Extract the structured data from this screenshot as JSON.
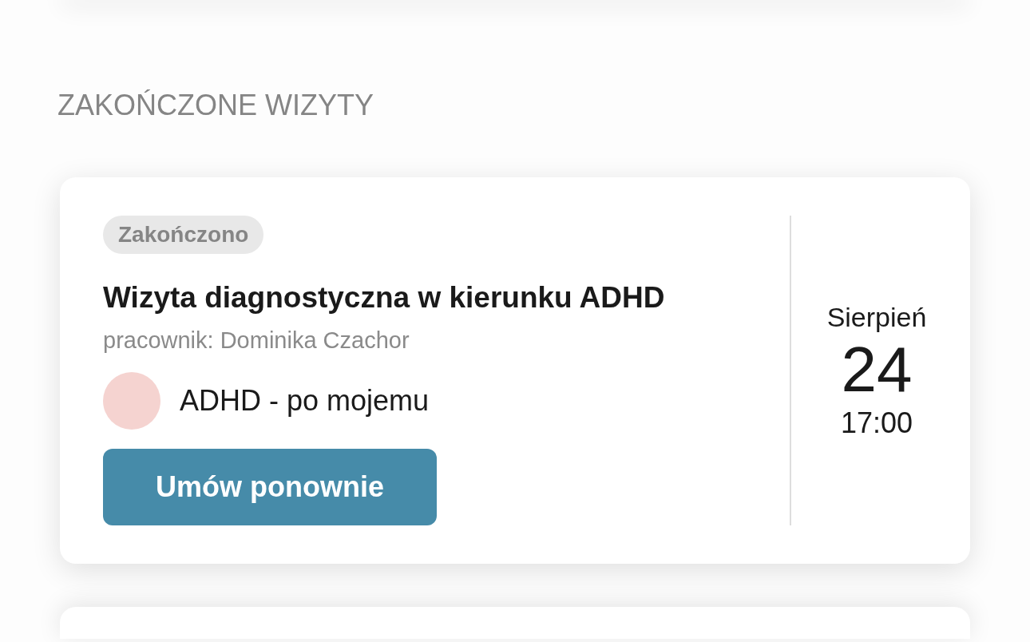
{
  "section_title": "ZAKOŃCZONE WIZYTY",
  "visit": {
    "status": "Zakończono",
    "title": "Wizyta diagnostyczna w kierunku ADHD",
    "employee": "pracownik: Dominika Czachor",
    "service": "ADHD - po mojemu",
    "rebook_button": "Umów ponownie",
    "date": {
      "month": "Sierpień",
      "day": "24",
      "time": "17:00"
    }
  }
}
